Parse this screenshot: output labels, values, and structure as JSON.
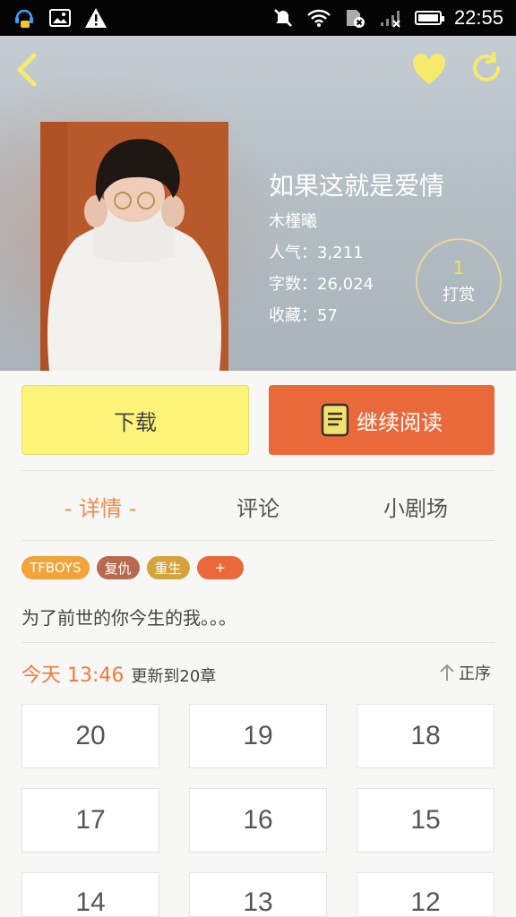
{
  "status_bar": {
    "time": "22:55",
    "left_icons": [
      "headset-chat-icon",
      "image-icon",
      "warning-icon"
    ],
    "right_icons": [
      "mute-icon",
      "wifi-icon",
      "sim-blocked-icon",
      "signal-icon",
      "battery-icon"
    ]
  },
  "header": {
    "book": {
      "title": "如果这就是爱情",
      "author": "木槿曦",
      "popularity": "人气：3,211",
      "word_count": "字数：26,024",
      "favorites": "收藏：57"
    },
    "tip": {
      "count": "1",
      "label": "打赏"
    }
  },
  "actions": {
    "download_label": "下载",
    "continue_label": "继续阅读"
  },
  "tabs": [
    {
      "label": "- 详情 -",
      "active": true
    },
    {
      "label": "评论",
      "active": false
    },
    {
      "label": "小剧场",
      "active": false
    }
  ],
  "tags": [
    {
      "label": "TFBOYS",
      "color": "#f3a33a"
    },
    {
      "label": "复仇",
      "color": "#b86a4e"
    },
    {
      "label": "重生",
      "color": "#d6a23a"
    },
    {
      "label": "+",
      "color": "#e9693b"
    }
  ],
  "description": "为了前世的你今生的我。。。",
  "update": {
    "time": "今天 13:46",
    "text": "更新到20章",
    "sort_label": "正序"
  },
  "chapters": [
    "20",
    "19",
    "18",
    "17",
    "16",
    "15",
    "14",
    "13",
    "12"
  ],
  "colors": {
    "accent_orange": "#e9693b",
    "download_yellow": "#fff47a"
  }
}
